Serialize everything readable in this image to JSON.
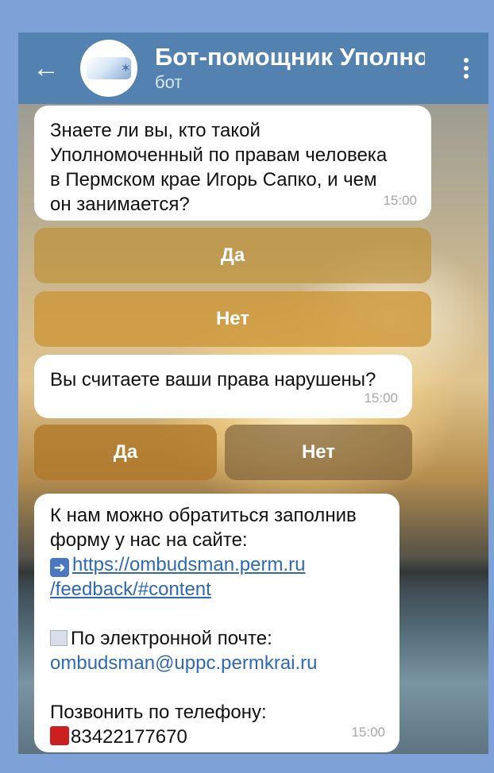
{
  "header": {
    "title": "Бот-помощник Уполно",
    "subtitle": "бот",
    "back_icon": "arrow-left-icon",
    "menu_icon": "more-vertical-icon"
  },
  "messages": [
    {
      "lines": [
        "Знаете ли вы, кто такой",
        "Уполномоченный по правам человека",
        "в Пермском крае Игорь Сапко, и чем",
        "он занимается?"
      ],
      "time": "15:00"
    },
    {
      "lines": [
        "Вы считаете ваши права нарушены?"
      ],
      "time": "15:00"
    },
    {
      "intro": [
        "К нам можно обратиться заполнив",
        "форму у нас на сайте:"
      ],
      "link_line1": "https://ombudsman.perm.ru",
      "link_line2": "/feedback/#content",
      "email_label": "По электронной почте:",
      "email": "ombudsman@uppc.permkrai.ru",
      "phone_label": "Позвонить по телефону:",
      "phone": "83422177670",
      "time": "15:00"
    }
  ],
  "keyboard1": {
    "yes": "Да",
    "no": "Нет"
  },
  "keyboard2": {
    "yes": "Да",
    "no": "Нет"
  },
  "colors": {
    "header": "#5381b0",
    "frame": "#7ea1d7",
    "link": "#2f68b4"
  }
}
